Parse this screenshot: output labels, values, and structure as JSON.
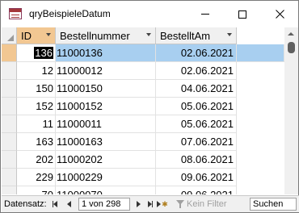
{
  "window": {
    "title": "qryBeispieleDatum"
  },
  "columns": [
    {
      "label": "ID"
    },
    {
      "label": "Bestellnummer"
    },
    {
      "label": "BestelltAm"
    }
  ],
  "rows": [
    {
      "id": "136",
      "nr": "11000136",
      "date": "02.06.2021",
      "current": true
    },
    {
      "id": "12",
      "nr": "11000012",
      "date": "02.06.2021"
    },
    {
      "id": "150",
      "nr": "11000150",
      "date": "04.06.2021"
    },
    {
      "id": "152",
      "nr": "11000152",
      "date": "05.06.2021"
    },
    {
      "id": "11",
      "nr": "11000011",
      "date": "05.06.2021"
    },
    {
      "id": "163",
      "nr": "11000163",
      "date": "07.06.2021"
    },
    {
      "id": "202",
      "nr": "11000202",
      "date": "08.06.2021"
    },
    {
      "id": "229",
      "nr": "11000229",
      "date": "09.06.2021"
    },
    {
      "id": "70",
      "nr": "11000070",
      "date": "09.06.2021"
    }
  ],
  "navigation": {
    "label": "Datensatz:",
    "position": "1 von 298",
    "filter_label": "Kein Filter",
    "search_placeholder": "Suchen"
  },
  "colors": {
    "selected_row": "#a8cff0",
    "active_header": "#f2c792",
    "access_red": "#a4373a"
  }
}
